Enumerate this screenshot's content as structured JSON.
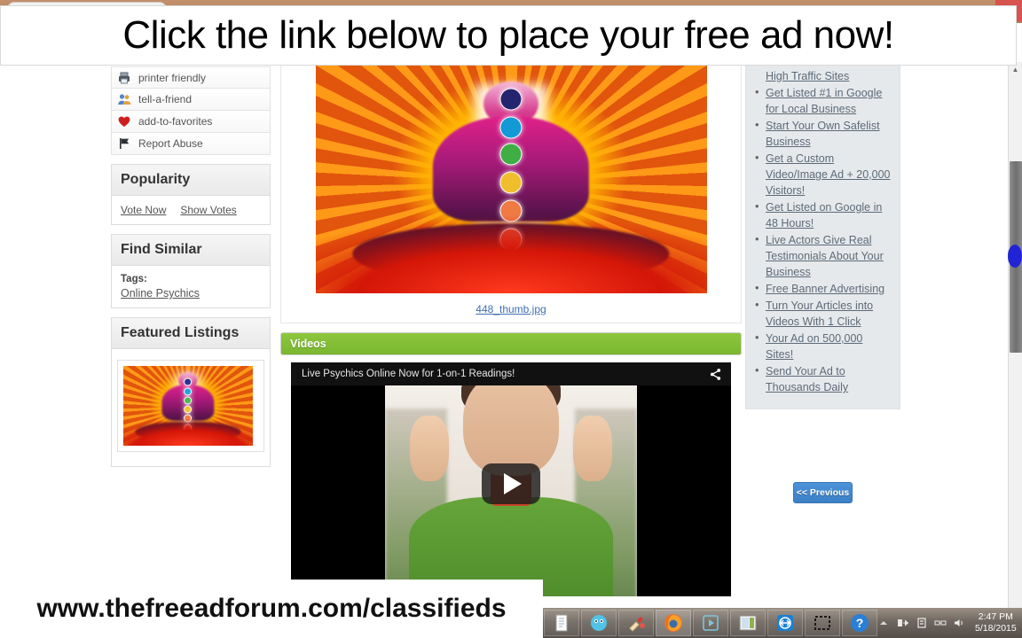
{
  "overlays": {
    "top_banner": "Click the link below to place your free ad now!",
    "bottom_banner": "www.thefreeadforum.com/classifieds"
  },
  "window": {
    "minimize_label": "–",
    "maximize_label": "▭",
    "close_label": "×"
  },
  "sidebar_left": {
    "actions": [
      {
        "label": "printer friendly",
        "icon": "printer-icon"
      },
      {
        "label": "tell-a-friend",
        "icon": "people-icon"
      },
      {
        "label": "add-to-favorites",
        "icon": "heart-icon"
      },
      {
        "label": "Report Abuse",
        "icon": "flag-icon"
      }
    ],
    "popularity": {
      "title": "Popularity",
      "vote_now": "Vote Now",
      "show_votes": "Show Votes"
    },
    "find_similar": {
      "title": "Find Similar",
      "tags_label": "Tags:",
      "tags": [
        "Online Psychics"
      ]
    },
    "featured": {
      "title": "Featured Listings"
    }
  },
  "main": {
    "image_caption": "448_thumb.jpg",
    "videos_header": "Videos",
    "video": {
      "title": "Live Psychics Online Now for 1-on-1 Readings!",
      "share_icon": "share-icon",
      "play_icon": "play-button-icon"
    }
  },
  "sidebar_right": {
    "links": [
      "High Traffic Sites",
      "Get Listed #1 in Google for Local Business",
      "Start Your Own Safelist Business",
      "Get a Custom Video/Image Ad + 20,000 Visitors!",
      "Get Listed on Google in 48 Hours!",
      "Live Actors Give Real Testimonials About Your Business",
      "Free Banner Advertising",
      "Turn Your Articles into Videos With 1 Click",
      "Your Ad on 500,000 Sites!",
      "Send Your Ad to Thousands Daily"
    ],
    "previous_button": "<< Previous"
  },
  "taskbar": {
    "items": [
      {
        "name": "notepad-icon"
      },
      {
        "name": "voicemail-icon"
      },
      {
        "name": "cleaner-icon"
      },
      {
        "name": "firefox-icon"
      },
      {
        "name": "media-player-icon"
      },
      {
        "name": "window-icon"
      },
      {
        "name": "teamviewer-icon"
      },
      {
        "name": "snipping-tool-icon"
      },
      {
        "name": "help-icon"
      }
    ],
    "tray": [
      {
        "name": "show-hidden-icons-arrow"
      },
      {
        "name": "network-share-icon"
      },
      {
        "name": "action-center-icon"
      },
      {
        "name": "network-icon"
      },
      {
        "name": "volume-icon"
      }
    ],
    "clock_time": "2:47 PM",
    "clock_date": "5/18/2015"
  },
  "scrollbar": {
    "up_arrow": "▲",
    "down_arrow": "▼"
  },
  "colors": {
    "videos_green": "#8cc63e",
    "link_blue": "#3f6fb5",
    "button_blue": "#3b7fc4",
    "titlebar_brown": "#b9875f"
  }
}
